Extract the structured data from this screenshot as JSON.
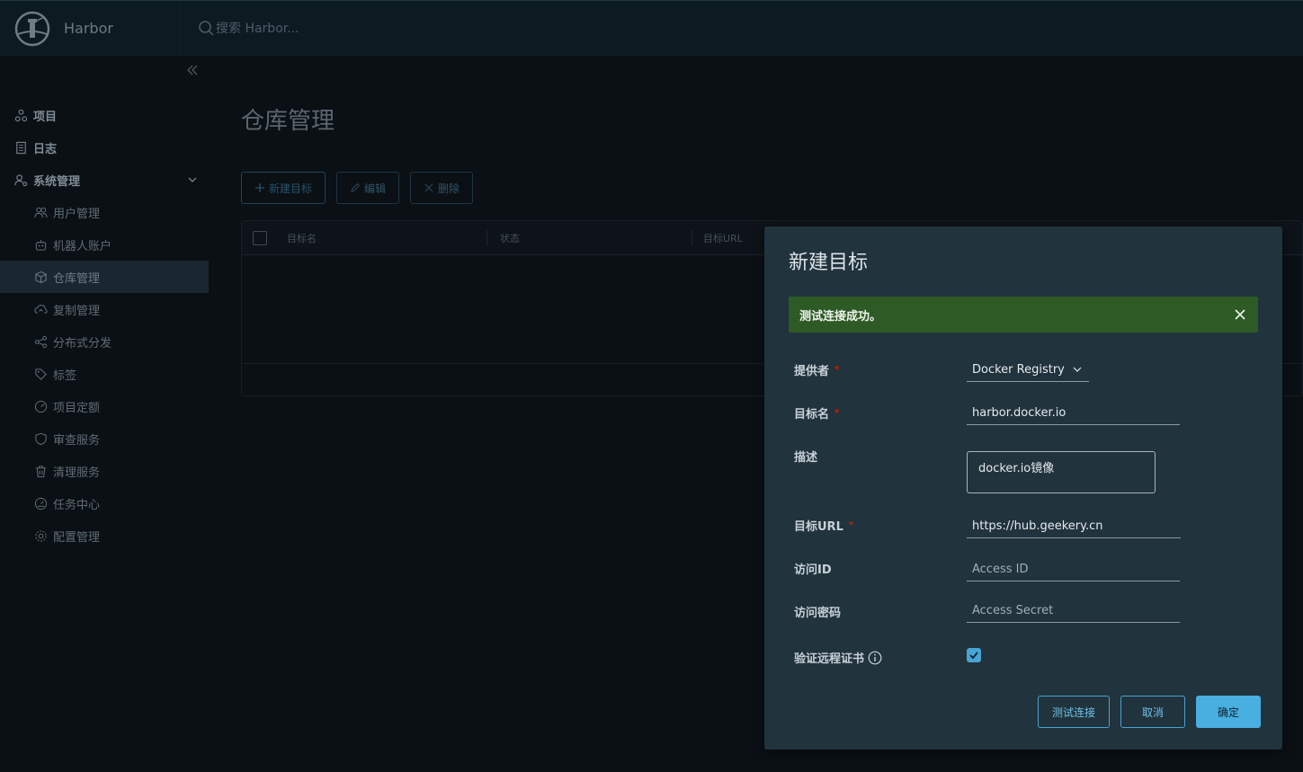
{
  "header": {
    "brand": "Harbor",
    "search_placeholder": "搜索 Harbor..."
  },
  "sidebar": {
    "items": [
      {
        "label": "项目",
        "icon": "projects-icon"
      },
      {
        "label": "日志",
        "icon": "logs-icon"
      },
      {
        "label": "系统管理",
        "icon": "admin-icon"
      }
    ],
    "admin_items": [
      {
        "label": "用户管理",
        "icon": "users-icon"
      },
      {
        "label": "机器人账户",
        "icon": "robot-icon"
      },
      {
        "label": "仓库管理",
        "icon": "registry-icon"
      },
      {
        "label": "复制管理",
        "icon": "replication-icon"
      },
      {
        "label": "分布式分发",
        "icon": "distribution-icon"
      },
      {
        "label": "标签",
        "icon": "tag-icon"
      },
      {
        "label": "项目定额",
        "icon": "quota-icon"
      },
      {
        "label": "审查服务",
        "icon": "shield-icon"
      },
      {
        "label": "清理服务",
        "icon": "trash-icon"
      },
      {
        "label": "任务中心",
        "icon": "dashboard-icon"
      },
      {
        "label": "配置管理",
        "icon": "gear-icon"
      }
    ]
  },
  "main": {
    "title": "仓库管理",
    "toolbar": {
      "new_label": "新建目标",
      "edit_label": "编辑",
      "delete_label": "删除"
    },
    "grid": {
      "columns": [
        "目标名",
        "状态",
        "目标URL"
      ]
    }
  },
  "modal": {
    "title": "新建目标",
    "alert": "测试连接成功。",
    "fields": {
      "provider": {
        "label": "提供者",
        "value": "Docker Registry"
      },
      "name": {
        "label": "目标名",
        "value": "harbor.docker.io"
      },
      "description": {
        "label": "描述",
        "value": "docker.io镜像"
      },
      "url": {
        "label": "目标URL",
        "value": "https://hub.geekery.cn"
      },
      "access_id": {
        "label": "访问ID",
        "placeholder": "Access ID"
      },
      "access_secret": {
        "label": "访问密码",
        "placeholder": "Access Secret"
      },
      "verify_cert": {
        "label": "验证远程证书",
        "checked": true
      }
    },
    "buttons": {
      "test": "测试连接",
      "cancel": "取消",
      "ok": "确定"
    }
  },
  "colors": {
    "accent": "#49aee0",
    "success": "#2d5a25",
    "required": "#c92100"
  }
}
